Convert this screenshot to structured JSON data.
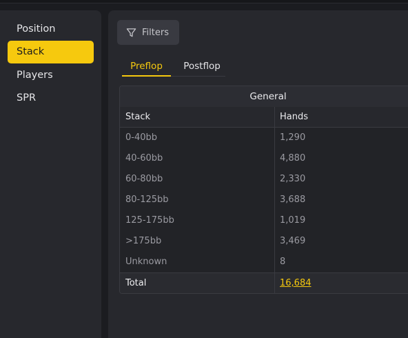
{
  "sidebar": {
    "items": [
      {
        "label": "Position"
      },
      {
        "label": "Stack"
      },
      {
        "label": "Players"
      },
      {
        "label": "SPR"
      }
    ],
    "active_index": 1
  },
  "toolbar": {
    "filters_label": "Filters",
    "filters_icon": "filter-icon"
  },
  "tabs": [
    {
      "label": "Preflop",
      "active": true
    },
    {
      "label": "Postflop",
      "active": false
    }
  ],
  "table": {
    "group_header": "General",
    "columns": [
      "Stack",
      "Hands"
    ],
    "rows": [
      [
        "0-40bb",
        "1,290"
      ],
      [
        "40-60bb",
        "4,880"
      ],
      [
        "60-80bb",
        "2,330"
      ],
      [
        "80-125bb",
        "3,688"
      ],
      [
        "125-175bb",
        "1,019"
      ],
      [
        ">175bb",
        "3,469"
      ],
      [
        "Unknown",
        "8"
      ]
    ],
    "total": {
      "label": "Total",
      "value": "16,684"
    }
  },
  "colors": {
    "accent": "#f6c90e",
    "panel": "#27282d",
    "background": "#1b1c20"
  }
}
